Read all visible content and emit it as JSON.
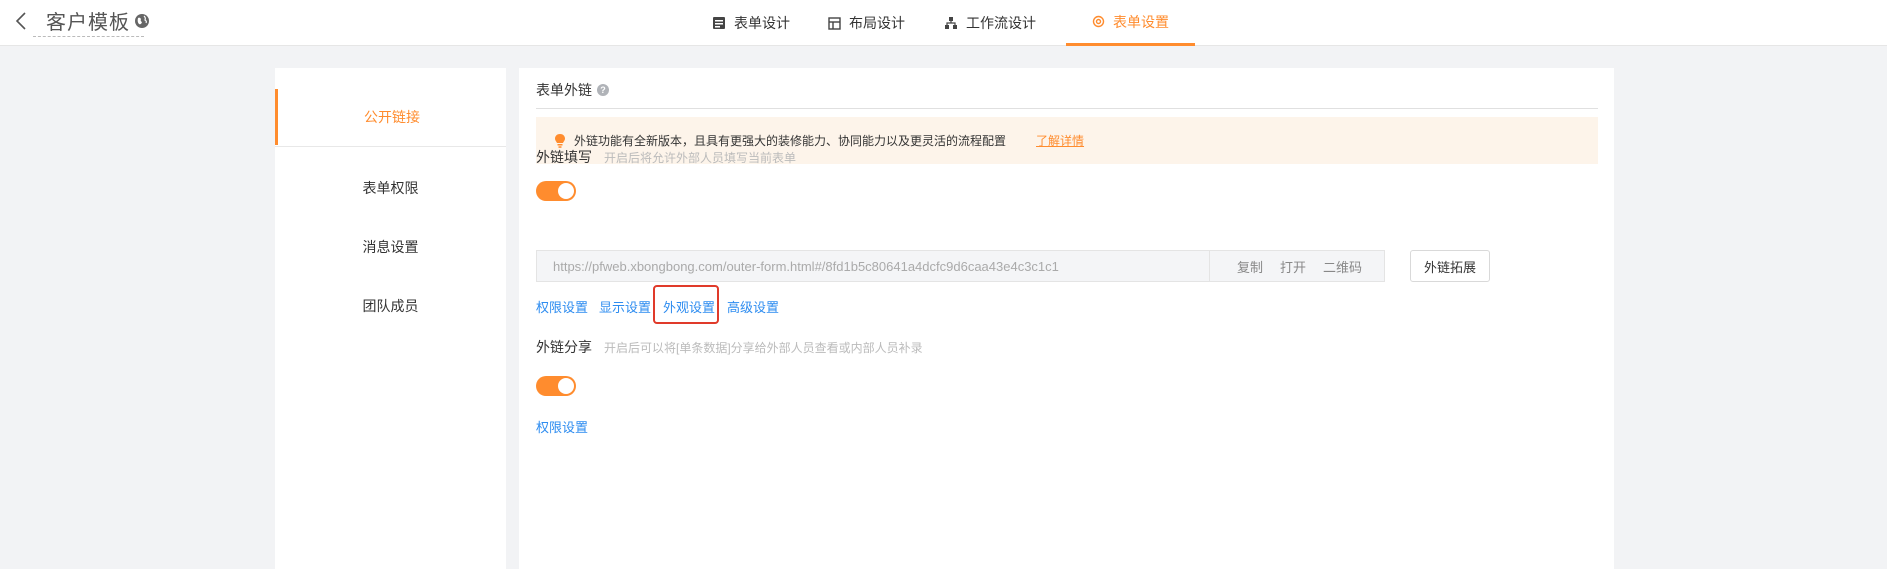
{
  "header": {
    "title": "客户模板",
    "tabs": [
      {
        "label": "表单设计",
        "icon": "form-icon"
      },
      {
        "label": "布局设计",
        "icon": "layout-icon"
      },
      {
        "label": "工作流设计",
        "icon": "workflow-icon"
      },
      {
        "label": "表单设置",
        "icon": "settings-icon",
        "active": true
      }
    ]
  },
  "leftnav": {
    "items": [
      {
        "label": "公开链接",
        "active": true
      },
      {
        "label": "表单权限"
      },
      {
        "label": "消息设置"
      },
      {
        "label": "团队成员"
      }
    ]
  },
  "main": {
    "section_title": "表单外链",
    "notice": {
      "text": "外链功能有全新版本，且具有更强大的装修能力、协同能力以及更灵活的流程配置",
      "link": "了解详情"
    },
    "external_fill": {
      "label": "外链填写",
      "hint": "开启后将允许外部人员填写当前表单",
      "enabled": true,
      "url": "https://pfweb.xbongbong.com/outer-form.html#/8fd1b5c80641a4dcfc9d6caa43e4c3c1c1",
      "actions": {
        "copy": "复制",
        "open": "打开",
        "qrcode": "二维码"
      },
      "expand_button": "外链拓展",
      "settings_links": [
        "权限设置",
        "显示设置",
        "外观设置",
        "高级设置"
      ]
    },
    "external_share": {
      "label": "外链分享",
      "hint": "开启后可以将[单条数据]分享给外部人员查看或内部人员补录",
      "enabled": true,
      "settings_link": "权限设置"
    }
  },
  "colors": {
    "accent": "#ff8c2e",
    "link": "#2d8cf0",
    "highlight": "#e03a2a",
    "notice_bg": "#fdf4ea"
  }
}
